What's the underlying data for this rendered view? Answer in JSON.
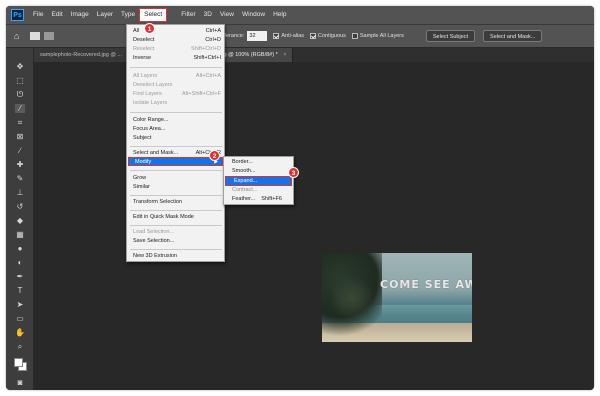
{
  "app": {
    "logo": "Ps"
  },
  "menubar": {
    "items": [
      "File",
      "Edit",
      "Image",
      "Layer",
      "Type",
      "Select",
      "Filter",
      "3D",
      "View",
      "Window",
      "Help"
    ]
  },
  "options": {
    "tolerance_label": "Tolerance:",
    "tolerance_value": "32",
    "anti_alias": "Anti-alias",
    "contiguous": "Contiguous",
    "sample_all_layers": "Sample All Layers",
    "select_subject": "Select Subject",
    "select_and_mask": "Select and Mask..."
  },
  "tabs": [
    {
      "label": "samplephoto-Recovered.jpg @ ...",
      "close": ""
    },
    {
      "label": "images.jpg @ 100% (RGB/8#) *",
      "close": "×"
    }
  ],
  "select_menu": {
    "items": [
      {
        "label": "All",
        "shortcut": "Ctrl+A"
      },
      {
        "label": "Deselect",
        "shortcut": "Ctrl+D"
      },
      {
        "label": "Reselect",
        "shortcut": "Shift+Ctrl+D"
      },
      {
        "label": "Inverse",
        "shortcut": "Shift+Ctrl+I"
      },
      {
        "label": "All Layers",
        "shortcut": "Alt+Ctrl+A"
      },
      {
        "label": "Deselect Layers",
        "shortcut": ""
      },
      {
        "label": "Find Layers",
        "shortcut": "Alt+Shift+Ctrl+F"
      },
      {
        "label": "Isolate Layers",
        "shortcut": ""
      },
      {
        "label": "Color Range...",
        "shortcut": ""
      },
      {
        "label": "Focus Area...",
        "shortcut": ""
      },
      {
        "label": "Subject",
        "shortcut": ""
      },
      {
        "label": "Select and Mask...",
        "shortcut": "Alt+Ctrl+R"
      },
      {
        "label": "Modify",
        "shortcut": ""
      },
      {
        "label": "Grow",
        "shortcut": ""
      },
      {
        "label": "Similar",
        "shortcut": ""
      },
      {
        "label": "Transform Selection",
        "shortcut": ""
      },
      {
        "label": "Edit in Quick Mask Mode",
        "shortcut": ""
      },
      {
        "label": "Load Selection...",
        "shortcut": ""
      },
      {
        "label": "Save Selection...",
        "shortcut": ""
      },
      {
        "label": "New 3D Extrusion",
        "shortcut": ""
      }
    ]
  },
  "modify_submenu": {
    "items": [
      {
        "label": "Border...",
        "shortcut": ""
      },
      {
        "label": "Smooth...",
        "shortcut": ""
      },
      {
        "label": "Expand...",
        "shortcut": ""
      },
      {
        "label": "Contract...",
        "shortcut": ""
      },
      {
        "label": "Feather...",
        "shortcut": "Shift+F6"
      }
    ]
  },
  "badges": [
    "1",
    "2",
    "3"
  ],
  "canvas": {
    "image_text": "COME SEE AWAY"
  },
  "colors": {
    "highlight": "#1473e6",
    "badge": "#e03131",
    "menubar": "#535353",
    "canvas": "#282828"
  }
}
